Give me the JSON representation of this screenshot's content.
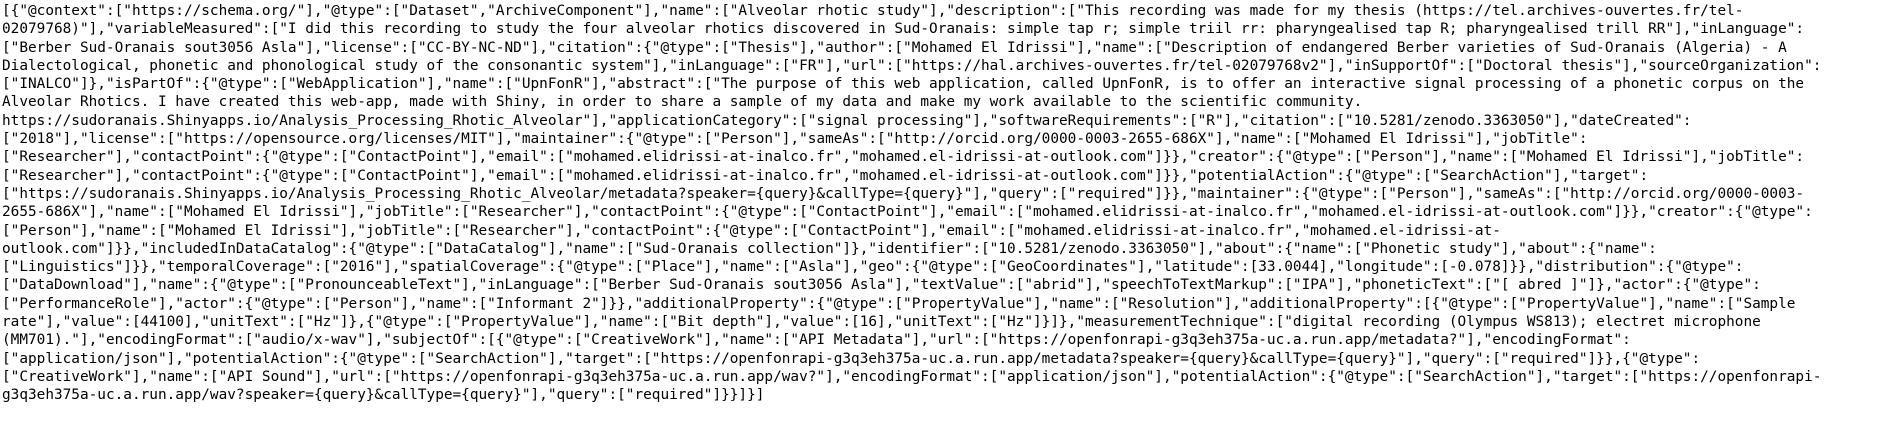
{
  "document": {
    "lines": [
      "[{\"@context\":[\"https://schema.org/\"],\"@type\":[\"Dataset\",\"ArchiveComponent\"],\"name\":[\"Alveolar rhotic study\"],\"description\":[\"This recording was made for my thesis (https://tel.archives-ouvertes.fr/tel-",
      "02079768)\"],\"variableMeasured\":[\"I did this recording to study the four alveolar rhotics discovered in Sud-Oranais: simple tap r; simple triil rr: pharyngealised tap R; pharyngealised trill RR\"],\"inLanguage\":",
      "[\"Berber Sud-Oranais sout3056 Asla\"],\"license\":[\"CC-BY-NC-ND\"],\"citation\":{\"@type\":[\"Thesis\"],\"author\":[\"Mohamed El Idrissi\"],\"name\":[\"Description of endangered Berber varieties of Sud-Oranais (Algeria) - A",
      "Dialectological, phonetic and phonological study of the consonantic system\"],\"inLanguage\":[\"FR\"],\"url\":[\"https://hal.archives-ouvertes.fr/tel-02079768v2\"],\"inSupportOf\":[\"Doctoral thesis\"],\"sourceOrganization\":",
      "[\"INALCO\"]},\"isPartOf\":{\"@type\":[\"WebApplication\"],\"name\":[\"UpnFonR\"],\"abstract\":[\"The purpose of this web application, called UpnFonR, is to offer an interactive signal processing of a phonetic corpus on the",
      "Alveolar Rhotics. I have created this web-app, made with Shiny, in order to share a sample of my data and make my work available to the scientific community.",
      "https://sudoranais.Shinyapps.io/Analysis_Processing_Rhotic_Alveolar\"],\"applicationCategory\":[\"signal processing\"],\"softwareRequirements\":[\"R\"],\"citation\":[\"10.5281/zenodo.3363050\"],\"dateCreated\":",
      "[\"2018\"],\"license\":[\"https://opensource.org/licenses/MIT\"],\"maintainer\":{\"@type\":[\"Person\"],\"sameAs\":[\"http://orcid.org/0000-0003-2655-686X\"],\"name\":[\"Mohamed El Idrissi\"],\"jobTitle\":",
      "[\"Researcher\"],\"contactPoint\":{\"@type\":[\"ContactPoint\"],\"email\":[\"mohamed.elidrissi-at-inalco.fr\",\"mohamed.el-idrissi-at-outlook.com\"]}},\"creator\":{\"@type\":[\"Person\"],\"name\":[\"Mohamed El Idrissi\"],\"jobTitle\":",
      "[\"Researcher\"],\"contactPoint\":{\"@type\":[\"ContactPoint\"],\"email\":[\"mohamed.elidrissi-at-inalco.fr\",\"mohamed.el-idrissi-at-outlook.com\"]}},\"potentialAction\":{\"@type\":[\"SearchAction\"],\"target\":",
      "[\"https://sudoranais.Shinyapps.io/Analysis_Processing_Rhotic_Alveolar/metadata?speaker={query}&callType={query}\"],\"query\":[\"required\"]}},\"maintainer\":{\"@type\":[\"Person\"],\"sameAs\":[\"http://orcid.org/0000-0003-",
      "2655-686X\"],\"name\":[\"Mohamed El Idrissi\"],\"jobTitle\":[\"Researcher\"],\"contactPoint\":{\"@type\":[\"ContactPoint\"],\"email\":[\"mohamed.elidrissi-at-inalco.fr\",\"mohamed.el-idrissi-at-outlook.com\"]}},\"creator\":{\"@type\":",
      "[\"Person\"],\"name\":[\"Mohamed El Idrissi\"],\"jobTitle\":[\"Researcher\"],\"contactPoint\":{\"@type\":[\"ContactPoint\"],\"email\":[\"mohamed.elidrissi-at-inalco.fr\",\"mohamed.el-idrissi-at-",
      "outlook.com\"]}},\"includedInDataCatalog\":{\"@type\":[\"DataCatalog\"],\"name\":[\"Sud-Oranais collection\"]},\"identifier\":[\"10.5281/zenodo.3363050\"],\"about\":{\"name\":[\"Phonetic study\"],\"about\":{\"name\":",
      "[\"Linguistics\"]}},\"temporalCoverage\":[\"2016\"],\"spatialCoverage\":{\"@type\":[\"Place\"],\"name\":[\"Asla\"],\"geo\":{\"@type\":[\"GeoCoordinates\"],\"latitude\":[33.0044],\"longitude\":[-0.078]}},\"distribution\":{\"@type\":",
      "[\"DataDownload\"],\"name\":{\"@type\":[\"PronounceableText\"],\"inLanguage\":[\"Berber Sud-Oranais sout3056 Asla\"],\"textValue\":[\"abrid\"],\"speechToTextMarkup\":[\"IPA\"],\"phoneticText\":[\"[ abred ]\"]},\"actor\":{\"@type\":",
      "[\"PerformanceRole\"],\"actor\":{\"@type\":[\"Person\"],\"name\":[\"Informant 2\"]}},\"additionalProperty\":{\"@type\":[\"PropertyValue\"],\"name\":[\"Resolution\"],\"additionalProperty\":[{\"@type\":[\"PropertyValue\"],\"name\":[\"Sample",
      "rate\"],\"value\":[44100],\"unitText\":[\"Hz\"]},{\"@type\":[\"PropertyValue\"],\"name\":[\"Bit depth\"],\"value\":[16],\"unitText\":[\"Hz\"]}]},\"measurementTechnique\":[\"digital recording (Olympus WS813); electret microphone",
      "(MM701).\"],\"encodingFormat\":[\"audio/x-wav\"],\"subjectOf\":[{\"@type\":[\"CreativeWork\"],\"name\":[\"API Metadata\"],\"url\":[\"https://openfonrapi-g3q3eh375a-uc.a.run.app/metadata?\"],\"encodingFormat\":",
      "[\"application/json\"],\"potentialAction\":{\"@type\":[\"SearchAction\"],\"target\":[\"https://openfonrapi-g3q3eh375a-uc.a.run.app/metadata?speaker={query}&callType={query}\"],\"query\":[\"required\"]}},{\"@type\":",
      "[\"CreativeWork\"],\"name\":[\"API Sound\"],\"url\":[\"https://openfonrapi-g3q3eh375a-uc.a.run.app/wav?\"],\"encodingFormat\":[\"application/json\"],\"potentialAction\":{\"@type\":[\"SearchAction\"],\"target\":[\"https://openfonrapi-",
      "g3q3eh375a-uc.a.run.app/wav?speaker={query}&callType={query}\"],\"query\":[\"required\"]}}]}]"
    ]
  }
}
